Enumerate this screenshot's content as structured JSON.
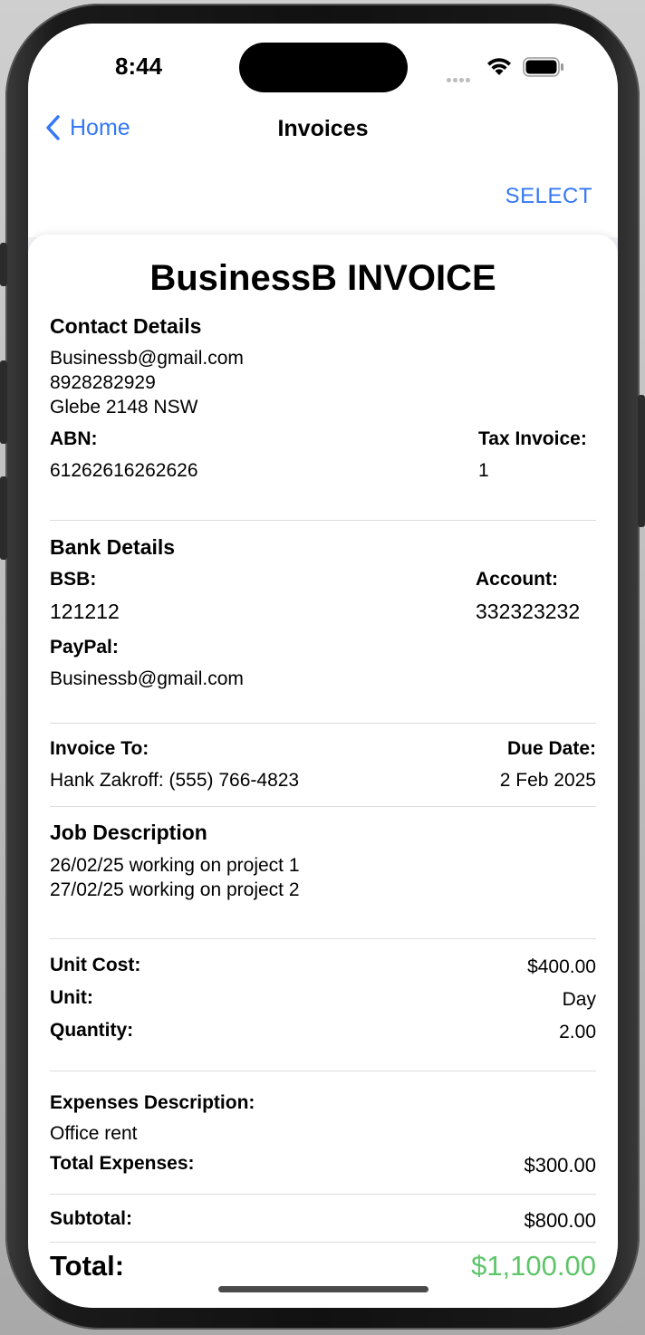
{
  "status_bar": {
    "time": "8:44"
  },
  "nav": {
    "back_label": "Home",
    "title": "Invoices",
    "select_label": "SELECT"
  },
  "invoice": {
    "title": "BusinessB INVOICE",
    "contact": {
      "heading": "Contact Details",
      "email": "Businessb@gmail.com",
      "phone": "8928282929",
      "address": "Glebe 2148 NSW"
    },
    "abn": {
      "label": "ABN:",
      "value": "61262616262626"
    },
    "tax_invoice": {
      "label": "Tax Invoice:",
      "value": "1"
    },
    "bank": {
      "heading": "Bank Details",
      "bsb_label": "BSB:",
      "bsb_value": "121212",
      "account_label": "Account:",
      "account_value": "332323232",
      "paypal_label": "PayPal:",
      "paypal_value": "Businessb@gmail.com"
    },
    "invoice_to": {
      "label": "Invoice To:",
      "value": "Hank Zakroff: (555) 766-4823"
    },
    "due_date": {
      "label": "Due Date:",
      "value": "2 Feb 2025"
    },
    "job": {
      "heading": "Job Description",
      "lines": [
        "26/02/25 working on project 1",
        "27/02/25 working on project 2"
      ]
    },
    "cost": {
      "unit_cost_label": "Unit Cost:",
      "unit_cost_value": "$400.00",
      "unit_label": "Unit:",
      "unit_value": "Day",
      "quantity_label": "Quantity:",
      "quantity_value": "2.00"
    },
    "expenses": {
      "heading": "Expenses Description:",
      "description": "Office rent",
      "total_label": "Total Expenses:",
      "total_value": "$300.00"
    },
    "subtotal": {
      "label": "Subtotal:",
      "value": "$800.00"
    },
    "total": {
      "label": "Total:",
      "value": "$1,100.00"
    }
  },
  "colors": {
    "accent": "#3478f6",
    "total": "#5fc56a"
  },
  "icons": [
    "chevron-left-icon",
    "wifi-icon",
    "battery-icon",
    "cellular-signal-icon"
  ]
}
